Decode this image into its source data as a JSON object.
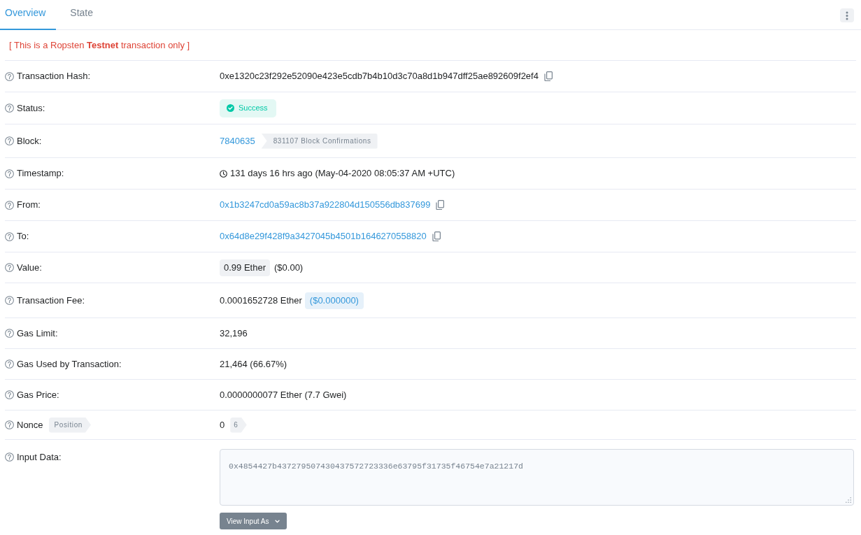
{
  "tabs": [
    {
      "label": "Overview",
      "selected": true
    },
    {
      "label": "State",
      "selected": false
    }
  ],
  "notice": "[ This is a Ropsten **Testnet** transaction only ]",
  "rows": [
    {
      "kind": "copyable",
      "label": "Transaction Hash:",
      "value": "0xe1320c23f292e52090e423e5cdb7b4b10d3c70a8d1b947dff25ae892609f2ef4",
      "link": false
    },
    {
      "kind": "status",
      "label": "Status:",
      "status": "Success"
    },
    {
      "kind": "block",
      "label": "Block:",
      "block": "7840635",
      "confirmations": "831107 Block Confirmations"
    },
    {
      "kind": "timestamp",
      "label": "Timestamp:",
      "value": "131 days 16 hrs ago (May-04-2020 08:05:37 AM +UTC)"
    },
    {
      "kind": "copyable",
      "label": "From:",
      "value": "0x1b3247cd0a59ac8b37a922804d150556db837699",
      "link": true
    },
    {
      "kind": "copyable",
      "label": "To:",
      "value": "0x64d8e29f428f9a3427045b4501b1646270558820",
      "link": true
    },
    {
      "kind": "value",
      "label": "Value:",
      "amount": "0.99 Ether",
      "usd": "($0.00)"
    },
    {
      "kind": "fee",
      "label": "Transaction Fee:",
      "amount": "0.0001652728 Ether",
      "usd": "($0.000000)"
    },
    {
      "kind": "text",
      "label": "Gas Limit:",
      "value": "32,196"
    },
    {
      "kind": "text",
      "label": "Gas Used by Transaction:",
      "value": "21,464 (66.67%)"
    },
    {
      "kind": "text",
      "label": "Gas Price:",
      "value": "0.0000000077 Ether (7.7 Gwei)"
    },
    {
      "kind": "nonce",
      "label": "Nonce",
      "label_tag": "Position",
      "value": "0",
      "tag": "6"
    },
    {
      "kind": "input",
      "label": "Input Data:",
      "value": "0x4854427b437279507430437572723336e63795f31735f46754e7a21217d",
      "button": "View Input As"
    }
  ]
}
